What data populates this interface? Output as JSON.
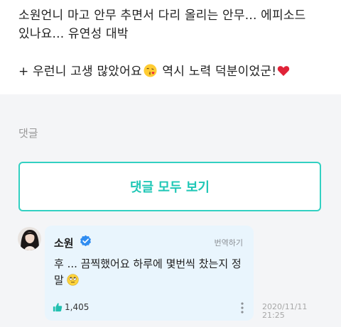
{
  "post": {
    "line1": "소원언니 마고 안무 추면서 다리 올리는 안무... 에피소드",
    "line2": "있나요... 유연성 대박",
    "line3_before_emoji": "+ 우런니 고생 많았어요",
    "line3_after_emoji": " 역시 노력 덕분이었군!",
    "icons": [
      "face-blowing-kiss-icon",
      "red-heart-icon"
    ]
  },
  "comments_section": {
    "label": "댓글",
    "view_all_label": "댓글 모두 보기",
    "accent_color": "#33d1c2"
  },
  "comment": {
    "author": "소원",
    "translate_label": "번역하기",
    "text": "후 ... 끔찍했어요 하루에 몇번씩 찼는지 정말",
    "like_count": "1,405",
    "date": "2020/11/11",
    "time": "21:25",
    "bubble_color": "#e9f5fd",
    "verified_color": "#2f8cf0",
    "like_color": "#21c0b0",
    "icons": [
      "avatar",
      "verified-badge-icon",
      "face-with-rolling-eyes-icon",
      "thumbs-up-icon",
      "more-vertical-icon"
    ]
  }
}
